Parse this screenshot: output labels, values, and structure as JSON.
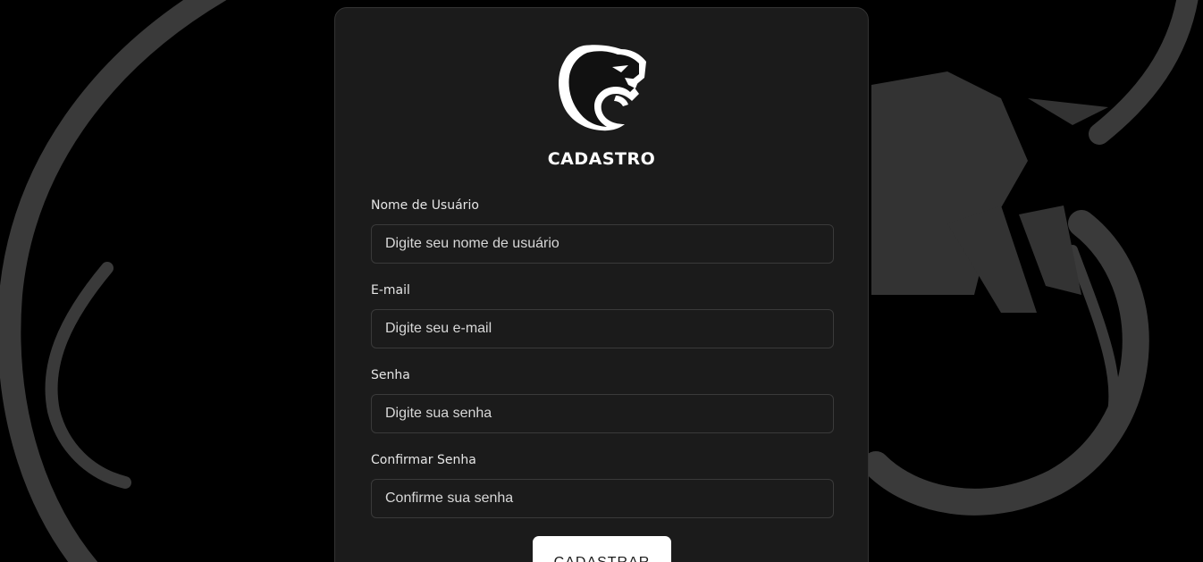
{
  "form": {
    "title": "CADASTRO",
    "fields": [
      {
        "label": "Nome de Usuário",
        "placeholder": "Digite seu nome de usuário",
        "value": ""
      },
      {
        "label": "E-mail",
        "placeholder": "Digite seu e-mail",
        "value": ""
      },
      {
        "label": "Senha",
        "placeholder": "Digite sua senha",
        "value": ""
      },
      {
        "label": "Confirmar Senha",
        "placeholder": "Confirme sua senha",
        "value": ""
      }
    ],
    "submit_label": "CADASTRAR"
  },
  "icons": {
    "logo": "panther-logo-icon",
    "background": "panther-watermark"
  },
  "colors": {
    "page_background": "#000000",
    "card_background": "#1b1b1b",
    "watermark": "#3a3a3a",
    "button_background": "#ffffff",
    "text": "#ffffff"
  }
}
